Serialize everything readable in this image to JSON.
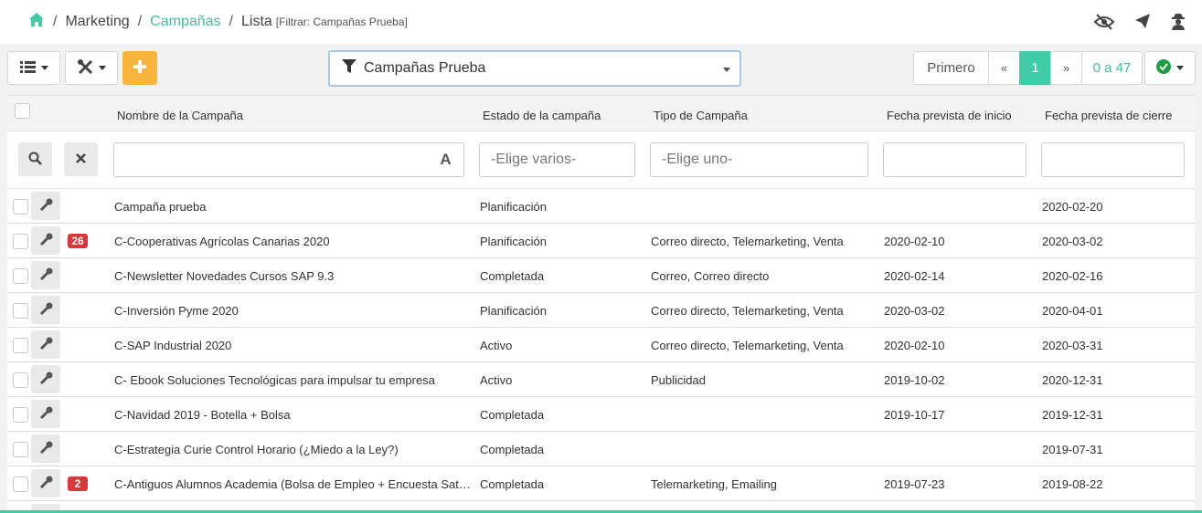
{
  "breadcrumb": {
    "level1": "Marketing",
    "level2": "Campañas",
    "level3": "Lista",
    "filter_note": "[Filtrar: Campañas Prueba]",
    "separator": "/"
  },
  "top_icons": [
    "eye-slash-icon",
    "paper-plane-icon",
    "user-secret-icon"
  ],
  "toolbar": {
    "filter_label": "Campañas Prueba",
    "add_label": "+"
  },
  "pagination": {
    "first": "Primero",
    "prev": "«",
    "current": "1",
    "next": "»",
    "range": "0 a 47"
  },
  "table": {
    "headers": [
      "Nombre de la Campaña",
      "Estado de la campaña",
      "Tipo de Campaña",
      "Fecha prevista de inicio",
      "Fecha prevista de cierre"
    ],
    "filters": {
      "estado_placeholder": "-Elige varios-",
      "tipo_placeholder": "-Elige uno-",
      "a_button": "A"
    },
    "rows": [
      {
        "badge": "",
        "name": "Campaña prueba",
        "status": "Planificación",
        "type": "",
        "start": "",
        "end": "2020-02-20"
      },
      {
        "badge": "26",
        "name": "C-Cooperativas Agrícolas Canarias 2020",
        "status": "Planificación",
        "type": "Correo directo, Telemarketing, Venta",
        "start": "2020-02-10",
        "end": "2020-03-02"
      },
      {
        "badge": "",
        "name": "C-Newsletter Novedades Cursos SAP 9.3",
        "status": "Completada",
        "type": "Correo, Correo directo",
        "start": "2020-02-14",
        "end": "2020-02-16"
      },
      {
        "badge": "",
        "name": "C-Inversión Pyme 2020",
        "status": "Planificación",
        "type": "Correo directo, Telemarketing, Venta",
        "start": "2020-03-02",
        "end": "2020-04-01"
      },
      {
        "badge": "",
        "name": "C-SAP Industrial 2020",
        "status": "Activo",
        "type": "Correo directo, Telemarketing, Venta",
        "start": "2020-02-10",
        "end": "2020-03-31"
      },
      {
        "badge": "",
        "name": "C- Ebook Soluciones Tecnológicas para impulsar tu empresa",
        "status": "Activo",
        "type": "Publicidad",
        "start": "2019-10-02",
        "end": "2020-12-31"
      },
      {
        "badge": "",
        "name": "C-Navidad 2019 - Botella + Bolsa",
        "status": "Completada",
        "type": "",
        "start": "2019-10-17",
        "end": "2019-12-31"
      },
      {
        "badge": "",
        "name": "C-Estrategia Curie Control Horario (¿Miedo a la Ley?)",
        "status": "Completada",
        "type": "",
        "start": "",
        "end": "2019-07-31"
      },
      {
        "badge": "2",
        "name": "C-Antiguos Alumnos Academia (Bolsa de Empleo + Encuesta Satisfacción)",
        "status": "Completada",
        "type": "Telemarketing, Emailing",
        "start": "2019-07-23",
        "end": "2019-08-22"
      }
    ]
  },
  "colors": {
    "accent": "#3fcca6",
    "add_button": "#f9b43c",
    "badge": "#d9363e"
  }
}
